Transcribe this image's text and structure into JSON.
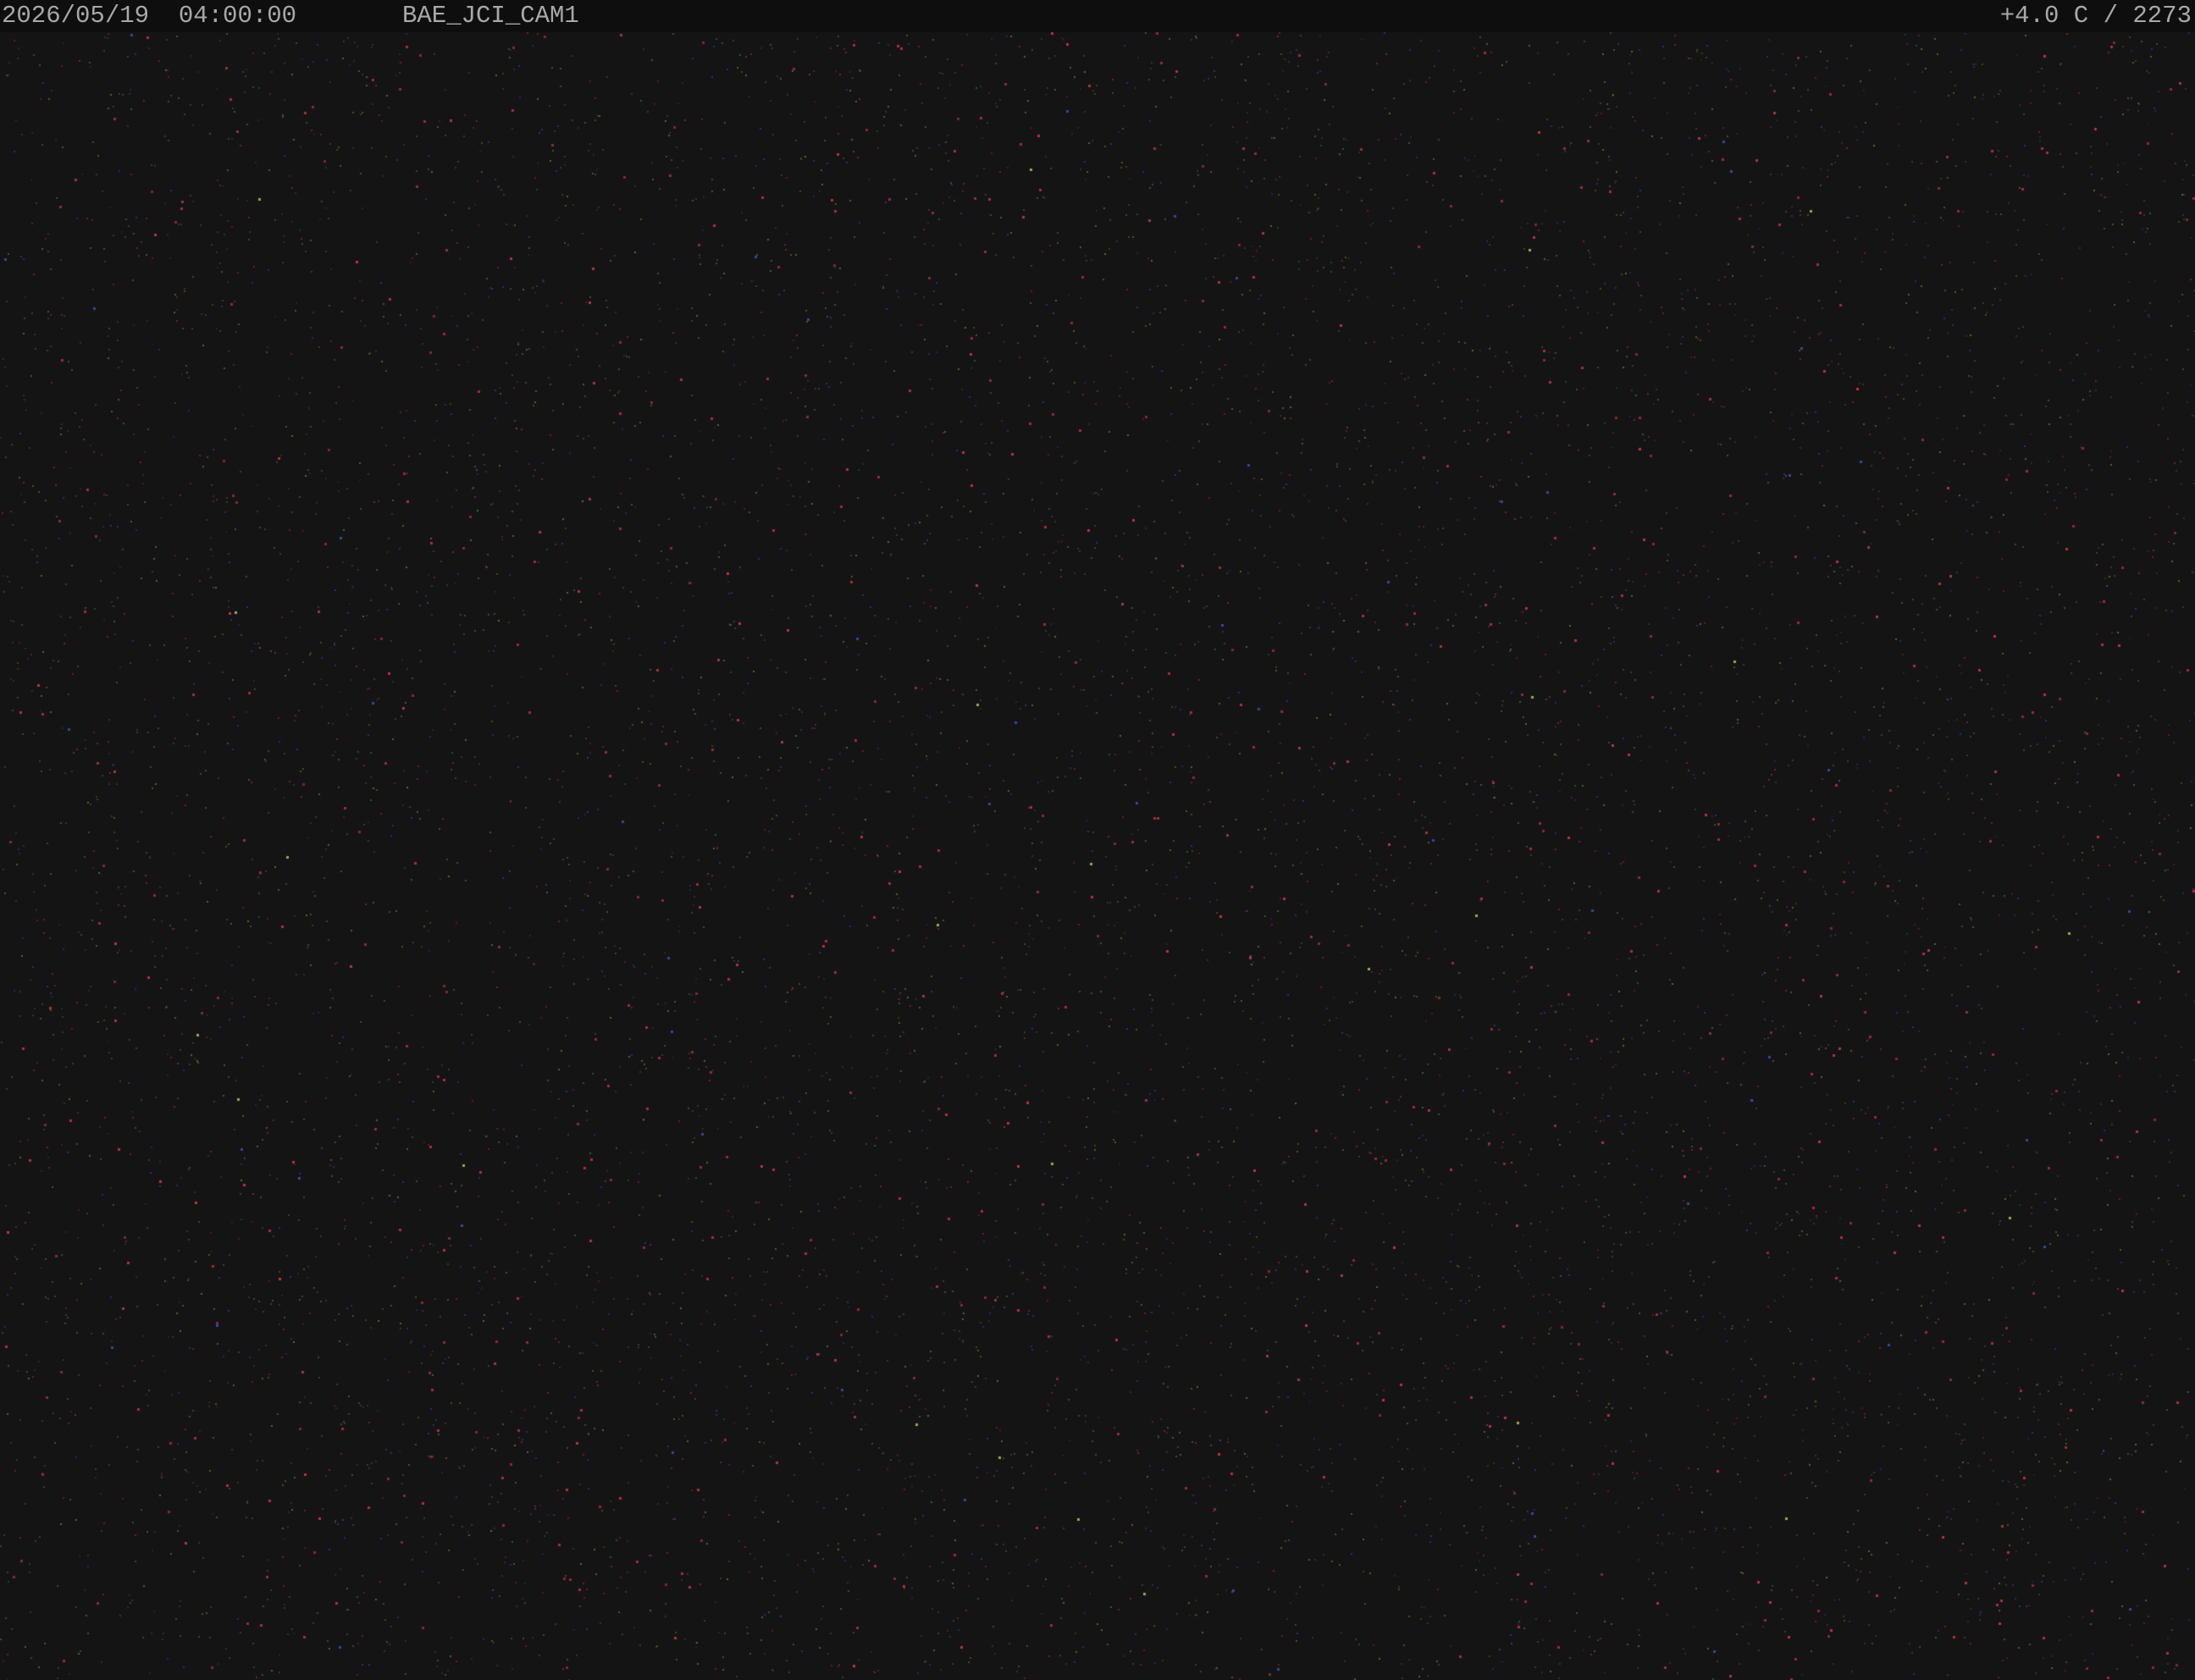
{
  "overlay": {
    "date": "2026/05/19",
    "time": "04:00:00",
    "camera_id": "BAE_JCI_CAM1",
    "temperature": "+4.0 C",
    "separator": "/",
    "counter": "2273",
    "text_color": "#a8a8a8"
  },
  "scene": {
    "description_colors": {
      "background": "#141415",
      "pixel_noise": [
        "#8a2a3a",
        "#4a6a3a",
        "#3a3a8a",
        "#7a7a40"
      ]
    }
  }
}
